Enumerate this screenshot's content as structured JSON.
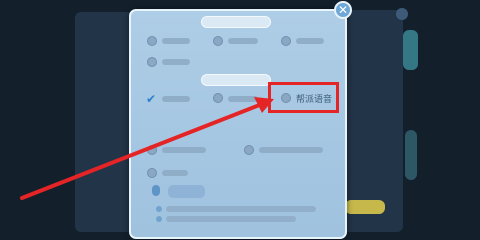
{
  "dialog": {
    "close_glyph": "✕",
    "highlighted_option_label": "帮派语音",
    "check_glyph": "✔"
  },
  "annotation": {
    "highlight_color": "#e52426",
    "arrow_color": "#e52426"
  }
}
